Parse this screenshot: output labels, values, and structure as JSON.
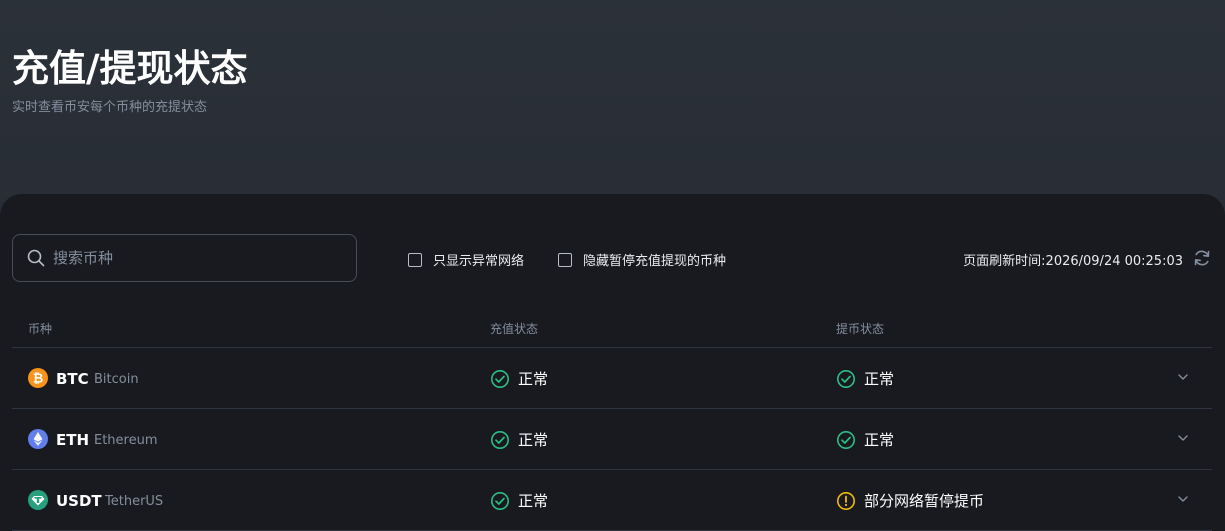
{
  "header": {
    "title": "充值/提现状态",
    "subtitle": "实时查看币安每个币种的充提状态"
  },
  "search": {
    "placeholder": "搜索币种",
    "value": ""
  },
  "filters": [
    {
      "label": "只显示异常网络",
      "checked": false
    },
    {
      "label": "隐藏暂停充值提现的币种",
      "checked": false
    }
  ],
  "refresh": {
    "text": "页面刷新时间:2026/09/24 00:25:03"
  },
  "table": {
    "columns": [
      "币种",
      "充值状态",
      "提币状态"
    ],
    "rows": [
      {
        "symbol": "BTC",
        "name": "Bitcoin",
        "icon": "bitcoin-icon",
        "deposit": "正常",
        "deposit_status": "ok",
        "withdraw": "正常",
        "withdraw_status": "ok"
      },
      {
        "symbol": "ETH",
        "name": "Ethereum",
        "icon": "ethereum-icon",
        "deposit": "正常",
        "deposit_status": "ok",
        "withdraw": "正常",
        "withdraw_status": "ok"
      },
      {
        "symbol": "USDT",
        "name": "TetherUS",
        "icon": "tether-icon",
        "deposit": "正常",
        "deposit_status": "ok",
        "withdraw": "部分网络暂停提币",
        "withdraw_status": "warning"
      }
    ]
  },
  "colors": {
    "ok": "#2ebd85",
    "warning": "#f0b90b",
    "btc": "#f7931a",
    "eth": "#627eea",
    "usdt": "#26a17b"
  }
}
